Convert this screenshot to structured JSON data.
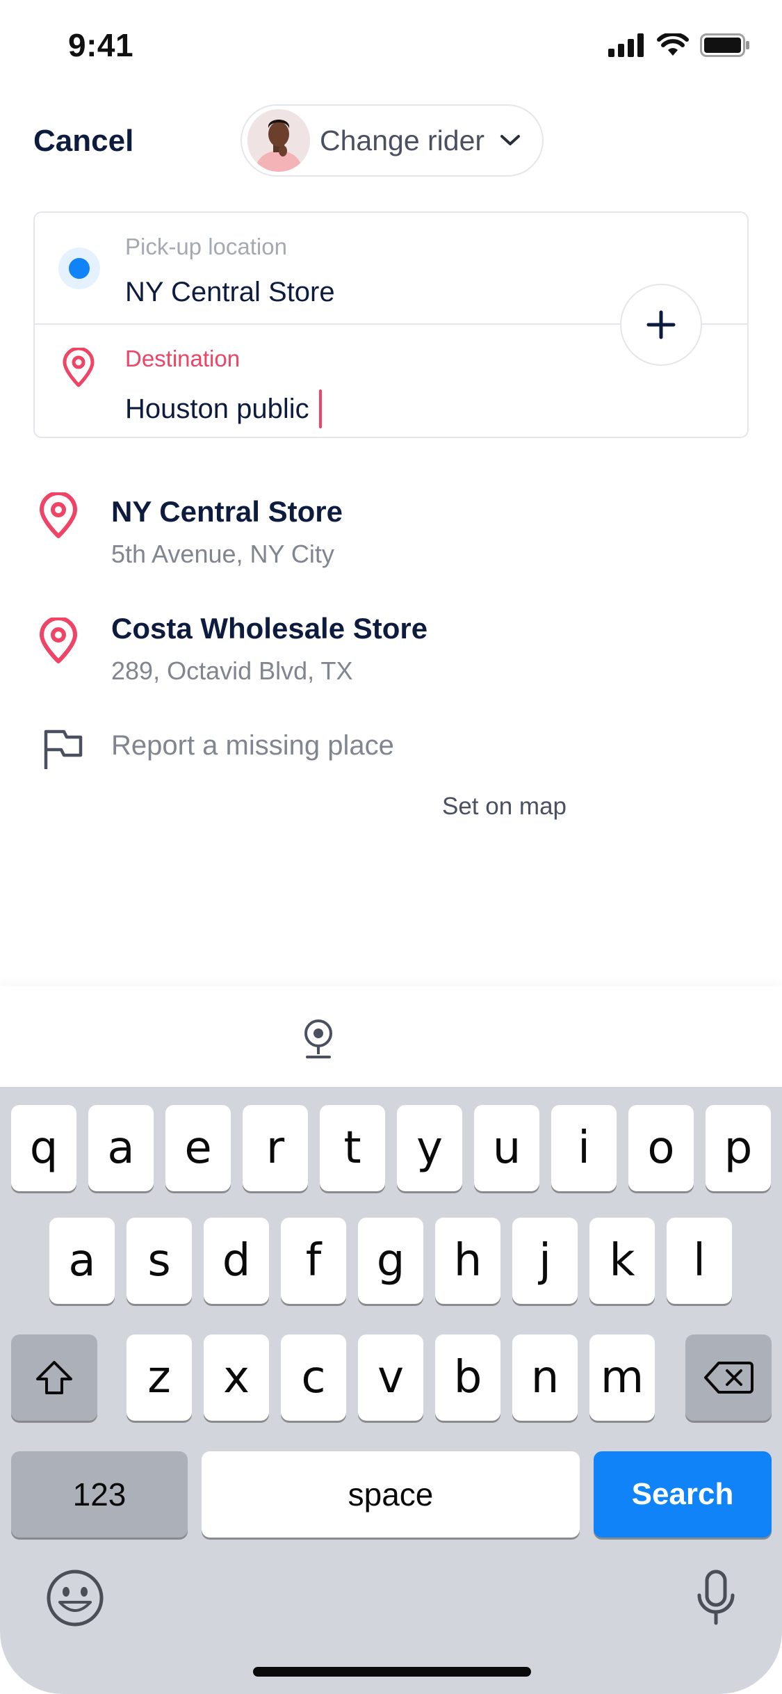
{
  "status_bar": {
    "time": "9:41"
  },
  "header": {
    "cancel_label": "Cancel",
    "rider_label": "Change rider"
  },
  "route": {
    "pickup_label": "Pick-up location",
    "pickup_value": "NY Central Store",
    "destination_label": "Destination",
    "destination_value": "Houston public"
  },
  "results": [
    {
      "title": "NY Central Store",
      "subtitle": "5th Avenue, NY City"
    },
    {
      "title": "Costa Wholesale Store",
      "subtitle": "289, Octavid Blvd, TX"
    }
  ],
  "report_missing_label": "Report a missing place",
  "set_on_map_label": "Set on map",
  "keyboard": {
    "row1": [
      "q",
      "a",
      "e",
      "r",
      "t",
      "y",
      "u",
      "i",
      "o",
      "p"
    ],
    "row2": [
      "a",
      "s",
      "d",
      "f",
      "g",
      "h",
      "j",
      "k",
      "l"
    ],
    "row3": [
      "z",
      "x",
      "c",
      "v",
      "b",
      "n",
      "m"
    ],
    "numbers_label": "123",
    "space_label": "space",
    "search_label": "Search"
  },
  "colors": {
    "accent_blue": "#0f83f7",
    "accent_pink": "#ef4466",
    "text_dark": "#0d1b3e",
    "keyboard_bg": "#d2d5db"
  }
}
